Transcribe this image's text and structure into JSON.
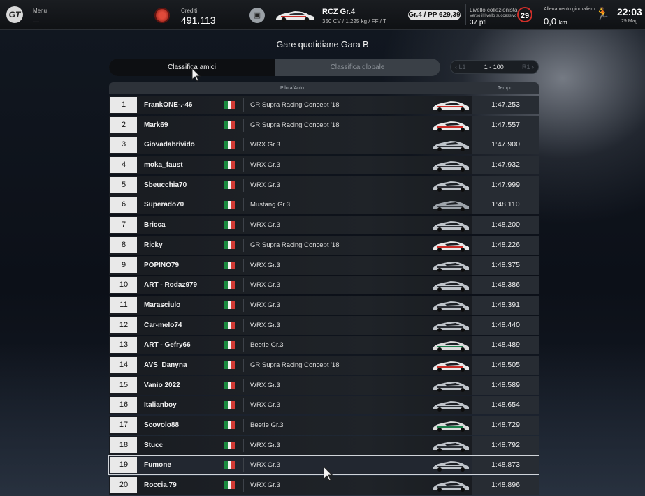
{
  "topbar": {
    "menu_label": "Menu",
    "menu_value": "---",
    "credits_label": "Crediti",
    "credits_value": "491.113",
    "car_name": "RCZ Gr.4",
    "car_specs": "350 CV / 1.225 kg / FF / T",
    "pp_badge": "Gr.4 / PP 629,39",
    "collector_label": "Livello collezionista",
    "collector_sub": "Verso il livello successivo",
    "collector_points": "37 pti",
    "collector_level": "29",
    "training_label": "Allenamento giornaliero",
    "training_value": "0,0",
    "training_unit": "km",
    "time": "22:03",
    "date": "29 Mag"
  },
  "page": {
    "title": "Gare quotidiane Gara B",
    "tab_friends": "Classifica amici",
    "tab_global": "Classifica globale",
    "pager_range": "1 - 100",
    "pager_prev": "L1",
    "pager_next": "R1"
  },
  "table": {
    "col_driver": "Pilota/Auto",
    "col_time": "Tempo",
    "rows": [
      {
        "rank": "1",
        "name": "FrankONE-.-46",
        "car": "GR Supra Racing Concept '18",
        "time": "1:47.253"
      },
      {
        "rank": "2",
        "name": "Mark69",
        "car": "GR Supra Racing Concept '18",
        "time": "1:47.557"
      },
      {
        "rank": "3",
        "name": "Giovadabrivido",
        "car": "WRX Gr.3",
        "time": "1:47.900"
      },
      {
        "rank": "4",
        "name": "moka_faust",
        "car": "WRX Gr.3",
        "time": "1:47.932"
      },
      {
        "rank": "5",
        "name": "Sbeucchia70",
        "car": "WRX Gr.3",
        "time": "1:47.999"
      },
      {
        "rank": "6",
        "name": "Superado70",
        "car": "Mustang Gr.3",
        "time": "1:48.110"
      },
      {
        "rank": "7",
        "name": "Bricca",
        "car": "WRX Gr.3",
        "time": "1:48.200"
      },
      {
        "rank": "8",
        "name": "Ricky",
        "car": "GR Supra Racing Concept '18",
        "time": "1:48.226"
      },
      {
        "rank": "9",
        "name": "POPINO79",
        "car": "WRX Gr.3",
        "time": "1:48.375"
      },
      {
        "rank": "10",
        "name": "ART - Rodaz979",
        "car": "WRX Gr.3",
        "time": "1:48.386"
      },
      {
        "rank": "11",
        "name": "Marasciulo",
        "car": "WRX Gr.3",
        "time": "1:48.391"
      },
      {
        "rank": "12",
        "name": "Car-melo74",
        "car": "WRX Gr.3",
        "time": "1:48.440"
      },
      {
        "rank": "13",
        "name": "ART - Gefry66",
        "car": "Beetle Gr.3",
        "time": "1:48.489"
      },
      {
        "rank": "14",
        "name": "AVS_Danyna",
        "car": "GR Supra Racing Concept '18",
        "time": "1:48.505"
      },
      {
        "rank": "15",
        "name": "Vanio 2022",
        "car": "WRX Gr.3",
        "time": "1:48.589"
      },
      {
        "rank": "16",
        "name": "Italianboy",
        "car": "WRX Gr.3",
        "time": "1:48.654"
      },
      {
        "rank": "17",
        "name": "Scovolo88",
        "car": "Beetle Gr.3",
        "time": "1:48.729"
      },
      {
        "rank": "18",
        "name": "Stucc",
        "car": "WRX Gr.3",
        "time": "1:48.792"
      },
      {
        "rank": "19",
        "name": "Fumone",
        "car": "WRX Gr.3",
        "time": "1:48.873"
      },
      {
        "rank": "20",
        "name": "Roccia.79",
        "car": "WRX Gr.3",
        "time": "1:48.896"
      }
    ]
  }
}
